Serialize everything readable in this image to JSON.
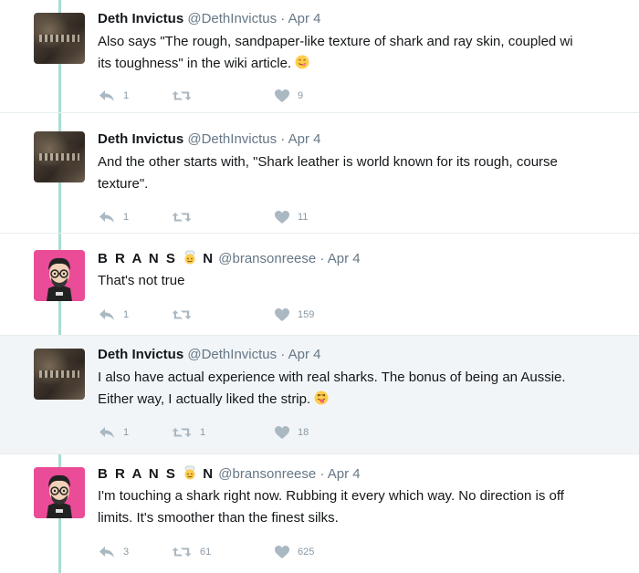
{
  "tweets": [
    {
      "name": "Deth Invictus",
      "handle": "@DethInvictus",
      "date": "Apr 4",
      "lines": [
        "Also says \"The rough, sandpaper-like texture of shark and ray skin, coupled wi",
        "its toughness\" in the wiki article."
      ],
      "emoji": "savoring-face-emoji",
      "replies": "1",
      "retweets": "",
      "likes": "9"
    },
    {
      "name": "Deth Invictus",
      "handle": "@DethInvictus",
      "date": "Apr 4",
      "lines": [
        "And the other starts with, \"Shark leather is world known for its rough, course",
        "texture\"."
      ],
      "replies": "1",
      "retweets": "",
      "likes": "11"
    },
    {
      "name_part1": "B R A N S",
      "name_part2": "N",
      "name_emoji": "chef-face-emoji",
      "handle": "@bransonreese",
      "date": "Apr 4",
      "lines": [
        "That's not true"
      ],
      "replies": "1",
      "retweets": "",
      "likes": "159"
    },
    {
      "name": "Deth Invictus",
      "handle": "@DethInvictus",
      "date": "Apr 4",
      "lines": [
        "I also have actual experience with real sharks.  The bonus of being an Aussie.",
        "Either way, I actually liked the strip."
      ],
      "emoji": "tongue-wink-emoji",
      "replies": "1",
      "retweets": "1",
      "likes": "18"
    },
    {
      "name_part1": "B R A N S",
      "name_part2": "N",
      "name_emoji": "chef-face-emoji",
      "handle": "@bransonreese",
      "date": "Apr 4",
      "lines": [
        "I'm touching a shark right now. Rubbing it every which way. No direction is off",
        "limits. It's smoother than the finest silks."
      ],
      "replies": "3",
      "retweets": "61",
      "likes": "625"
    }
  ],
  "separator": "·",
  "colors": {
    "thread_line": "#a8ddd0",
    "icon_gray": "#8899a6",
    "handle_gray": "#657786",
    "highlight_bg": "#f2f5f7",
    "avatar_pink": "#ea4c97"
  }
}
